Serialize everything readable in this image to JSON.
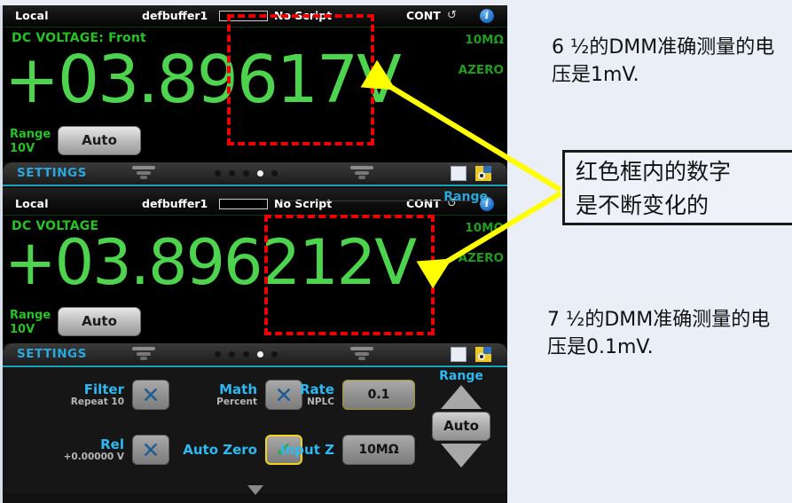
{
  "instrument": {
    "panel1": {
      "status": {
        "local": "Local",
        "buffer": "defbuffer1",
        "script": "No Script",
        "trigger": "CONT",
        "refresh_icon": "refresh-icon",
        "info_icon": "info-icon"
      },
      "mode_label": "DC VOLTAGE: Front",
      "reading": "+03.89617V",
      "right_notes": [
        "10MΩ",
        "AZERO"
      ],
      "range_label": "Range",
      "range_value": "10V",
      "range_button": "Auto"
    },
    "panel2": {
      "status": {
        "local": "Local",
        "buffer": "defbuffer1",
        "script": "No Script",
        "trigger": "CONT",
        "refresh_icon": "refresh-icon",
        "info_icon": "info-icon"
      },
      "bleed_range_label": "Range",
      "mode_label": "DC VOLTAGE",
      "reading": "+03.896212V",
      "right_notes": [
        "10MΩ",
        "AZERO"
      ],
      "range_label": "Range",
      "range_value": "10V",
      "range_button": "Auto"
    },
    "settings_strip": {
      "title": "SETTINGS",
      "dots_total": 5,
      "dots_active_index": 3,
      "left_chevron_icon": "chevron-down-icon",
      "right_chevron_icon": "chevron-down-icon",
      "icon_a": "display-grid-icon",
      "icon_b": "system-settings-icon"
    },
    "config_panel": {
      "items": [
        {
          "label": "Filter",
          "sub": "Repeat 10",
          "control": "x",
          "value": ""
        },
        {
          "label": "Math",
          "sub": "Percent",
          "control": "x",
          "value": ""
        },
        {
          "label": "Rate",
          "sub": "NPLC",
          "control": "value",
          "value": "0.1"
        },
        {
          "label": "Rel",
          "sub": "+0.00000 V",
          "control": "x",
          "value": ""
        },
        {
          "label": "Auto Zero",
          "sub": "",
          "control": "check",
          "value": ""
        },
        {
          "label": "Input Z",
          "sub": "",
          "control": "value",
          "value": "10MΩ"
        }
      ],
      "range_column": {
        "header": "Range",
        "up_icon": "triangle-up-icon",
        "auto_button": "Auto",
        "down_icon": "triangle-down-icon"
      }
    },
    "colors": {
      "reading_green": "#4ed34e",
      "label_green": "#24c324",
      "dim_green": "#1f9d1f",
      "accent_blue": "#2fb8ef",
      "highlight_red": "#ee0000",
      "arrow_yellow": "#ffff00",
      "selected_yellow": "#f2d21a"
    }
  },
  "annotations": {
    "note_top": "6 ½的DMM准确测量的电压是1mV.",
    "note_box": [
      "红色框内的数字",
      "是不断变化的"
    ],
    "note_bottom": "7 ½的DMM准确测量的电压是0.1mV."
  }
}
